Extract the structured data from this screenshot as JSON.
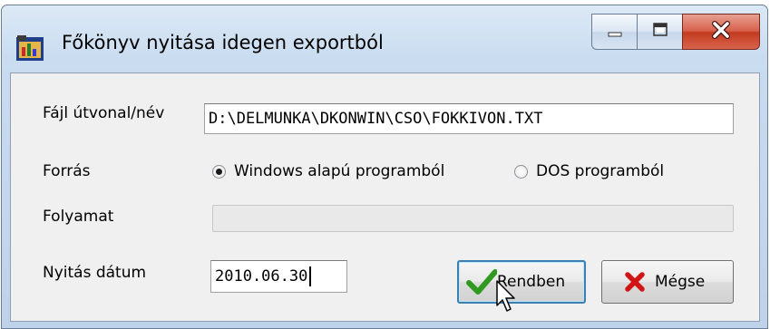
{
  "window": {
    "title": "Főkönyv nyitása idegen exportból",
    "title_icon": "ledger-app-icon",
    "controls": {
      "minimize": "minimize-icon",
      "maximize": "maximize-icon",
      "close": "close-icon"
    }
  },
  "form": {
    "file_label": "Fájl útvonal/név",
    "file_value": "D:\\DELMUNKA\\DKONWIN\\CSO\\FOKKIVON.TXT",
    "source_label": "Forrás",
    "source_options": [
      {
        "label": "Windows alapú programból",
        "selected": true
      },
      {
        "label": "DOS programból",
        "selected": false
      }
    ],
    "progress_label": "Folyamat",
    "progress_value": 0,
    "date_label": "Nyitás dátum",
    "date_value": "2010.06.30"
  },
  "buttons": {
    "ok_label": "Rendben",
    "ok_icon": "checkmark-icon",
    "cancel_label": "Mégse",
    "cancel_icon": "red-x-icon"
  },
  "colors": {
    "accent": "#3c7fb1",
    "close": "#c33a20",
    "check": "#2f9a1f",
    "cancel_x": "#d11414"
  }
}
